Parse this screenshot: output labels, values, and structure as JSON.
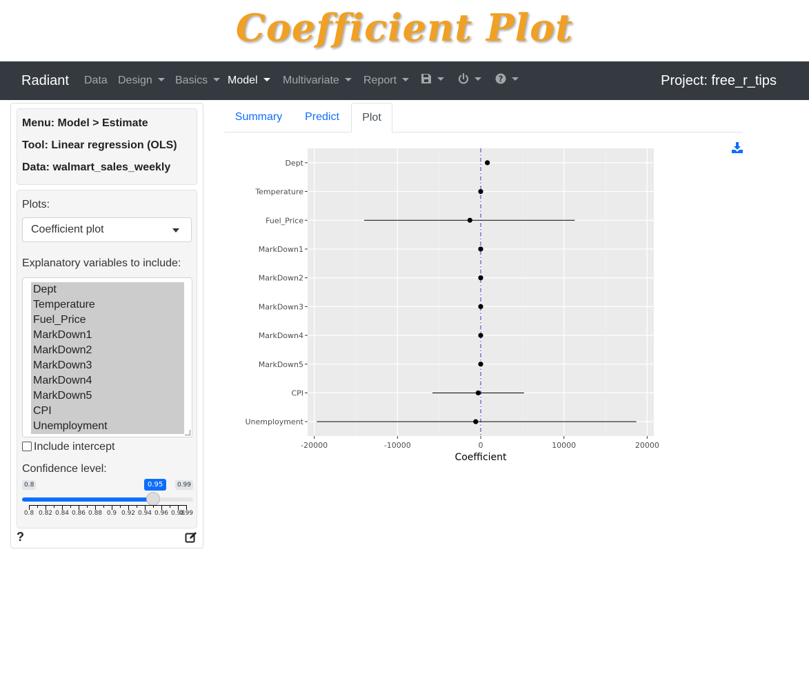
{
  "banner": {
    "title": "Coefficient Plot"
  },
  "navbar": {
    "brand": "Radiant",
    "items": [
      {
        "label": "Data",
        "dropdown": false,
        "active": false
      },
      {
        "label": "Design",
        "dropdown": true,
        "active": false
      },
      {
        "label": "Basics",
        "dropdown": true,
        "active": false
      },
      {
        "label": "Model",
        "dropdown": true,
        "active": true
      },
      {
        "label": "Multivariate",
        "dropdown": true,
        "active": false
      },
      {
        "label": "Report",
        "dropdown": true,
        "active": false
      }
    ],
    "icons": [
      "save-icon",
      "power-icon",
      "question-circle-icon"
    ],
    "project": "Project: free_r_tips"
  },
  "sidebar": {
    "menu": "Menu: Model > Estimate",
    "tool": "Tool: Linear regression (OLS)",
    "data": "Data: walmart_sales_weekly",
    "plots_label": "Plots:",
    "plots_selected": "Coefficient plot",
    "explanatory_label": "Explanatory variables to include:",
    "variables": [
      "Dept",
      "Temperature",
      "Fuel_Price",
      "MarkDown1",
      "MarkDown2",
      "MarkDown3",
      "MarkDown4",
      "MarkDown5",
      "CPI",
      "Unemployment"
    ],
    "include_intercept": "Include intercept",
    "include_intercept_checked": false,
    "confidence_label": "Confidence level:",
    "confidence": {
      "min": "0.8",
      "max": "0.99",
      "value": "0.95",
      "value_num": 0.95,
      "min_num": 0.8,
      "max_num": 0.99,
      "ticks": [
        "0.8",
        "0.82",
        "0.84",
        "0.86",
        "0.88",
        "0.9",
        "0.92",
        "0.94",
        "0.96",
        "0.98",
        "0.99"
      ]
    }
  },
  "tabs": [
    {
      "label": "Summary",
      "active": false
    },
    {
      "label": "Predict",
      "active": false
    },
    {
      "label": "Plot",
      "active": true
    }
  ],
  "icons": {
    "help": "?",
    "accent": "#0d6efd",
    "ref_line": "#6a5acd"
  },
  "chart_data": {
    "type": "scatter",
    "xlabel": "Coefficient",
    "ylabel": "",
    "xlim": [
      -20800,
      20800
    ],
    "xticks": [
      -20000,
      -10000,
      0,
      10000,
      20000
    ],
    "xtick_labels": [
      "-20000",
      "-10000",
      "0",
      "10000",
      "20000"
    ],
    "grid": true,
    "reference_line_x": 0,
    "categories": [
      "Dept",
      "Temperature",
      "Fuel_Price",
      "MarkDown1",
      "MarkDown2",
      "MarkDown3",
      "MarkDown4",
      "MarkDown5",
      "CPI",
      "Unemployment"
    ],
    "estimates": [
      800,
      0,
      -1300,
      0,
      0,
      0,
      0,
      0,
      -300,
      -600
    ],
    "ci_low": [
      800,
      0,
      -14000,
      0,
      0,
      0,
      0,
      0,
      -5800,
      -19700
    ],
    "ci_high": [
      800,
      0,
      11300,
      0,
      0,
      0,
      0,
      0,
      5200,
      18700
    ]
  }
}
